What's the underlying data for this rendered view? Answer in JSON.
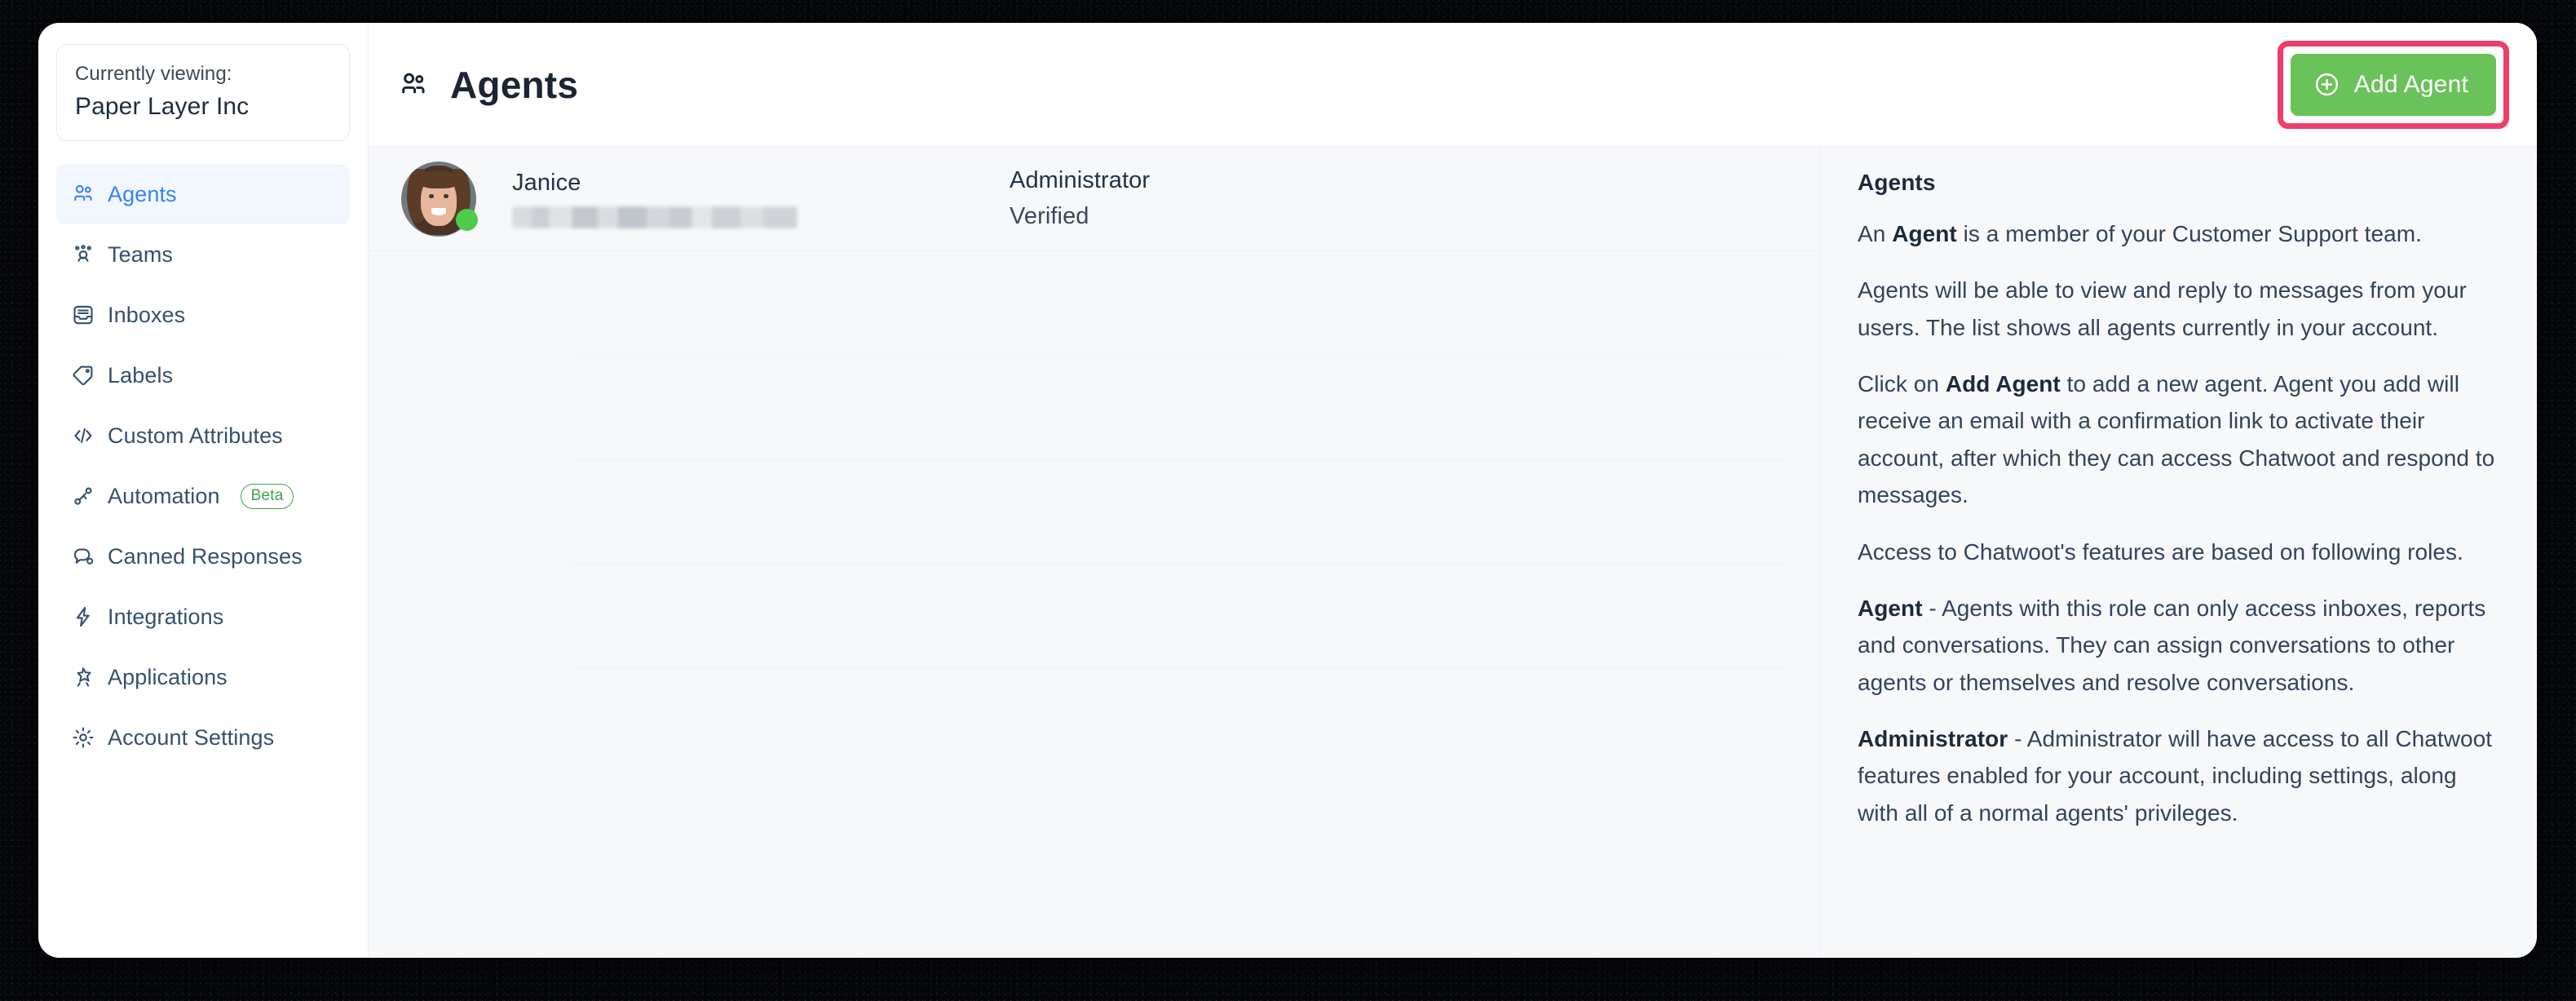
{
  "sidebar": {
    "org_card": {
      "caption": "Currently viewing:",
      "org_name": "Paper Layer Inc"
    },
    "items": [
      {
        "label": "Agents",
        "icon": "agents-icon",
        "active": true,
        "badge": null
      },
      {
        "label": "Teams",
        "icon": "teams-icon",
        "active": false,
        "badge": null
      },
      {
        "label": "Inboxes",
        "icon": "inbox-icon",
        "active": false,
        "badge": null
      },
      {
        "label": "Labels",
        "icon": "label-tag-icon",
        "active": false,
        "badge": null
      },
      {
        "label": "Custom Attributes",
        "icon": "code-brackets-icon",
        "active": false,
        "badge": null
      },
      {
        "label": "Automation",
        "icon": "automation-plug-icon",
        "active": false,
        "badge": "Beta"
      },
      {
        "label": "Canned Responses",
        "icon": "chat-bubbles-icon",
        "active": false,
        "badge": null
      },
      {
        "label": "Integrations",
        "icon": "lightning-bolt-icon",
        "active": false,
        "badge": null
      },
      {
        "label": "Applications",
        "icon": "star-burst-icon",
        "active": false,
        "badge": null
      },
      {
        "label": "Account Settings",
        "icon": "gear-icon",
        "active": false,
        "badge": null
      }
    ]
  },
  "topbar": {
    "title": "Agents",
    "title_icon": "agents-icon",
    "add_agent_label": "Add Agent",
    "add_agent_icon": "plus-circle-icon",
    "add_agent_color": "#6ac25a",
    "highlight_color": "#ef3d6b"
  },
  "agents": [
    {
      "name": "Janice",
      "email": "",
      "email_redacted": true,
      "role": "Administrator",
      "status": "Verified",
      "online": true,
      "online_color": "#4ccb4c"
    }
  ],
  "help": {
    "heading": "Agents",
    "paragraphs": [
      {
        "parts": [
          {
            "text": "An ",
            "bold": false
          },
          {
            "text": "Agent",
            "bold": true
          },
          {
            "text": " is a member of your Customer Support team.",
            "bold": false
          }
        ]
      },
      {
        "parts": [
          {
            "text": "Agents will be able to view and reply to messages from your users. The list shows all agents currently in your account.",
            "bold": false
          }
        ]
      },
      {
        "parts": [
          {
            "text": "Click on ",
            "bold": false
          },
          {
            "text": "Add Agent",
            "bold": true
          },
          {
            "text": " to add a new agent. Agent you add will receive an email with a confirmation link to activate their account, after which they can access Chatwoot and respond to messages.",
            "bold": false
          }
        ]
      },
      {
        "parts": [
          {
            "text": "Access to Chatwoot's features are based on following roles.",
            "bold": false
          }
        ]
      },
      {
        "parts": [
          {
            "text": "Agent",
            "bold": true
          },
          {
            "text": " - Agents with this role can only access inboxes, reports and conversations. They can assign conversations to other agents or themselves and resolve conversations.",
            "bold": false
          }
        ]
      },
      {
        "parts": [
          {
            "text": "Administrator",
            "bold": true
          },
          {
            "text": " - Administrator will have access to all Chatwoot features enabled for your account, including settings, along with all of a normal agents' privileges.",
            "bold": false
          }
        ]
      }
    ]
  },
  "colors": {
    "active_nav_text": "#3b82f6",
    "active_nav_bg": "#f2f6fd",
    "nav_text": "#37506e",
    "beta_badge": "#3fa34d",
    "content_bg": "#f7f8fa"
  }
}
